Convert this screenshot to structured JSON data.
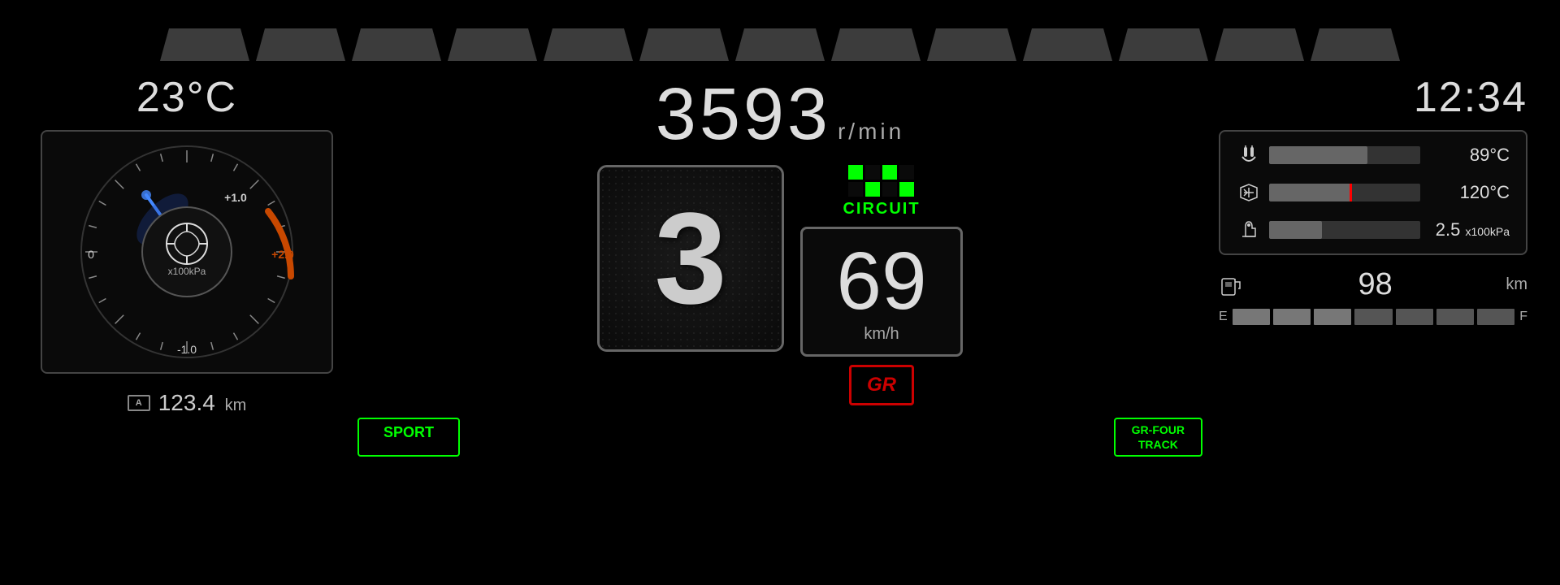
{
  "header": {
    "segments_count": 13
  },
  "left": {
    "temperature": "23",
    "temp_unit": "°C",
    "boost_labels": {
      "plus1": "+1.0",
      "zero": "0",
      "plus2": "+2.0",
      "minus1": "-1.0",
      "unit": "x100kPa"
    },
    "trip_label": "A",
    "trip_value": "123.4",
    "trip_unit": "km"
  },
  "center": {
    "rpm_value": "3593",
    "rpm_unit": "r/min",
    "gear": "3",
    "speed_value": "69",
    "speed_unit": "km/h",
    "circuit_label": "CIRCUIT",
    "sport_label": "SPORT",
    "gr_four_track_label": "GR-FOUR\nTRACK",
    "gr_logo": "GR"
  },
  "right": {
    "time": "12:34",
    "coolant_temp": "89",
    "coolant_unit": "°C",
    "coolant_fill": 65,
    "intake_temp": "120",
    "intake_unit": "°C",
    "intake_fill": 55,
    "oil_pressure": "2.5",
    "oil_unit": "x100kPa",
    "oil_fill": 35,
    "fuel_range": "98",
    "fuel_unit": "km",
    "fuel_segments": 7,
    "fuel_filled": 3
  }
}
